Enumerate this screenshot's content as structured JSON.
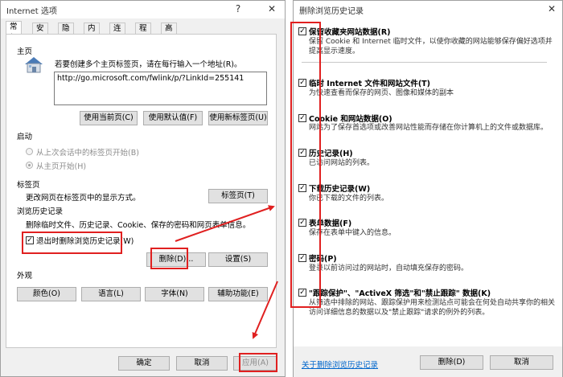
{
  "left_dialog": {
    "title": "Internet 选项",
    "help": "?",
    "close": "✕",
    "tabs": [
      "常规",
      "安全",
      "隐私",
      "内容",
      "连接",
      "程序",
      "高级"
    ],
    "home": {
      "heading": "主页",
      "instruction": "若要创建多个主页标签页，请在每行输入一个地址(R)。",
      "url": "http://go.microsoft.com/fwlink/p/?LinkId=255141",
      "btn_current": "使用当前页(C)",
      "btn_default": "使用默认值(F)",
      "btn_newtab": "使用新标签页(U)"
    },
    "startup": {
      "heading": "启动",
      "opt_last": "从上次会话中的标签页开始(B)",
      "opt_home": "从主页开始(H)"
    },
    "tabs_section": {
      "heading": "标签页",
      "desc": "更改网页在标签页中的显示方式。",
      "btn": "标签页(T)"
    },
    "history": {
      "heading": "浏览历史记录",
      "desc": "删除临时文件、历史记录、Cookie、保存的密码和网页表单信息。",
      "checkbox": "退出时删除浏览历史记录(W)",
      "btn_delete": "删除(D)...",
      "btn_settings": "设置(S)"
    },
    "appearance": {
      "heading": "外观",
      "btn_colors": "颜色(O)",
      "btn_language": "语言(L)",
      "btn_fonts": "字体(N)",
      "btn_accessibility": "辅助功能(E)"
    },
    "footer": {
      "ok": "确定",
      "cancel": "取消",
      "apply": "应用(A)"
    }
  },
  "right_dialog": {
    "title": "删除浏览历史记录",
    "options": [
      {
        "title": "保留收藏夹网站数据(R)",
        "desc": "保留 Cookie 和 Internet 临时文件，以使你收藏的网站能够保存偏好选项并提高显示速度。",
        "checked": true
      },
      {
        "title": "临时 Internet 文件和网站文件(T)",
        "desc": "为快速查看而保存的网页、图像和媒体的副本",
        "checked": true
      },
      {
        "title": "Cookie 和网站数据(O)",
        "desc": "网站为了保存首选项或改善网站性能而存储在你计算机上的文件或数据库。",
        "checked": true
      },
      {
        "title": "历史记录(H)",
        "desc": "已访问网站的列表。",
        "checked": true
      },
      {
        "title": "下载历史记录(W)",
        "desc": "你已下载的文件的列表。",
        "checked": true
      },
      {
        "title": "表单数据(F)",
        "desc": "保存在表单中键入的信息。",
        "checked": true
      },
      {
        "title": "密码(P)",
        "desc": "登录以前访问过的网站时，自动填充保存的密码。",
        "checked": true
      },
      {
        "title": "\"跟踪保护\"、\"ActiveX 筛选\"和\"禁止跟踪\" 数据(K)",
        "desc": "从筛选中排除的网站、跟踪保护用来检测站点可能会在何处自动共享你的相关访问详细信息的数据以及\"禁止跟踪\"请求的例外的列表。",
        "checked": true
      }
    ],
    "link": "关于删除浏览历史记录",
    "btn_delete": "删除(D)",
    "btn_cancel": "取消"
  },
  "colors": {
    "annotation_red": "#e02020",
    "link_blue": "#0066cc",
    "dialog_bg": "#f0f0f0"
  }
}
